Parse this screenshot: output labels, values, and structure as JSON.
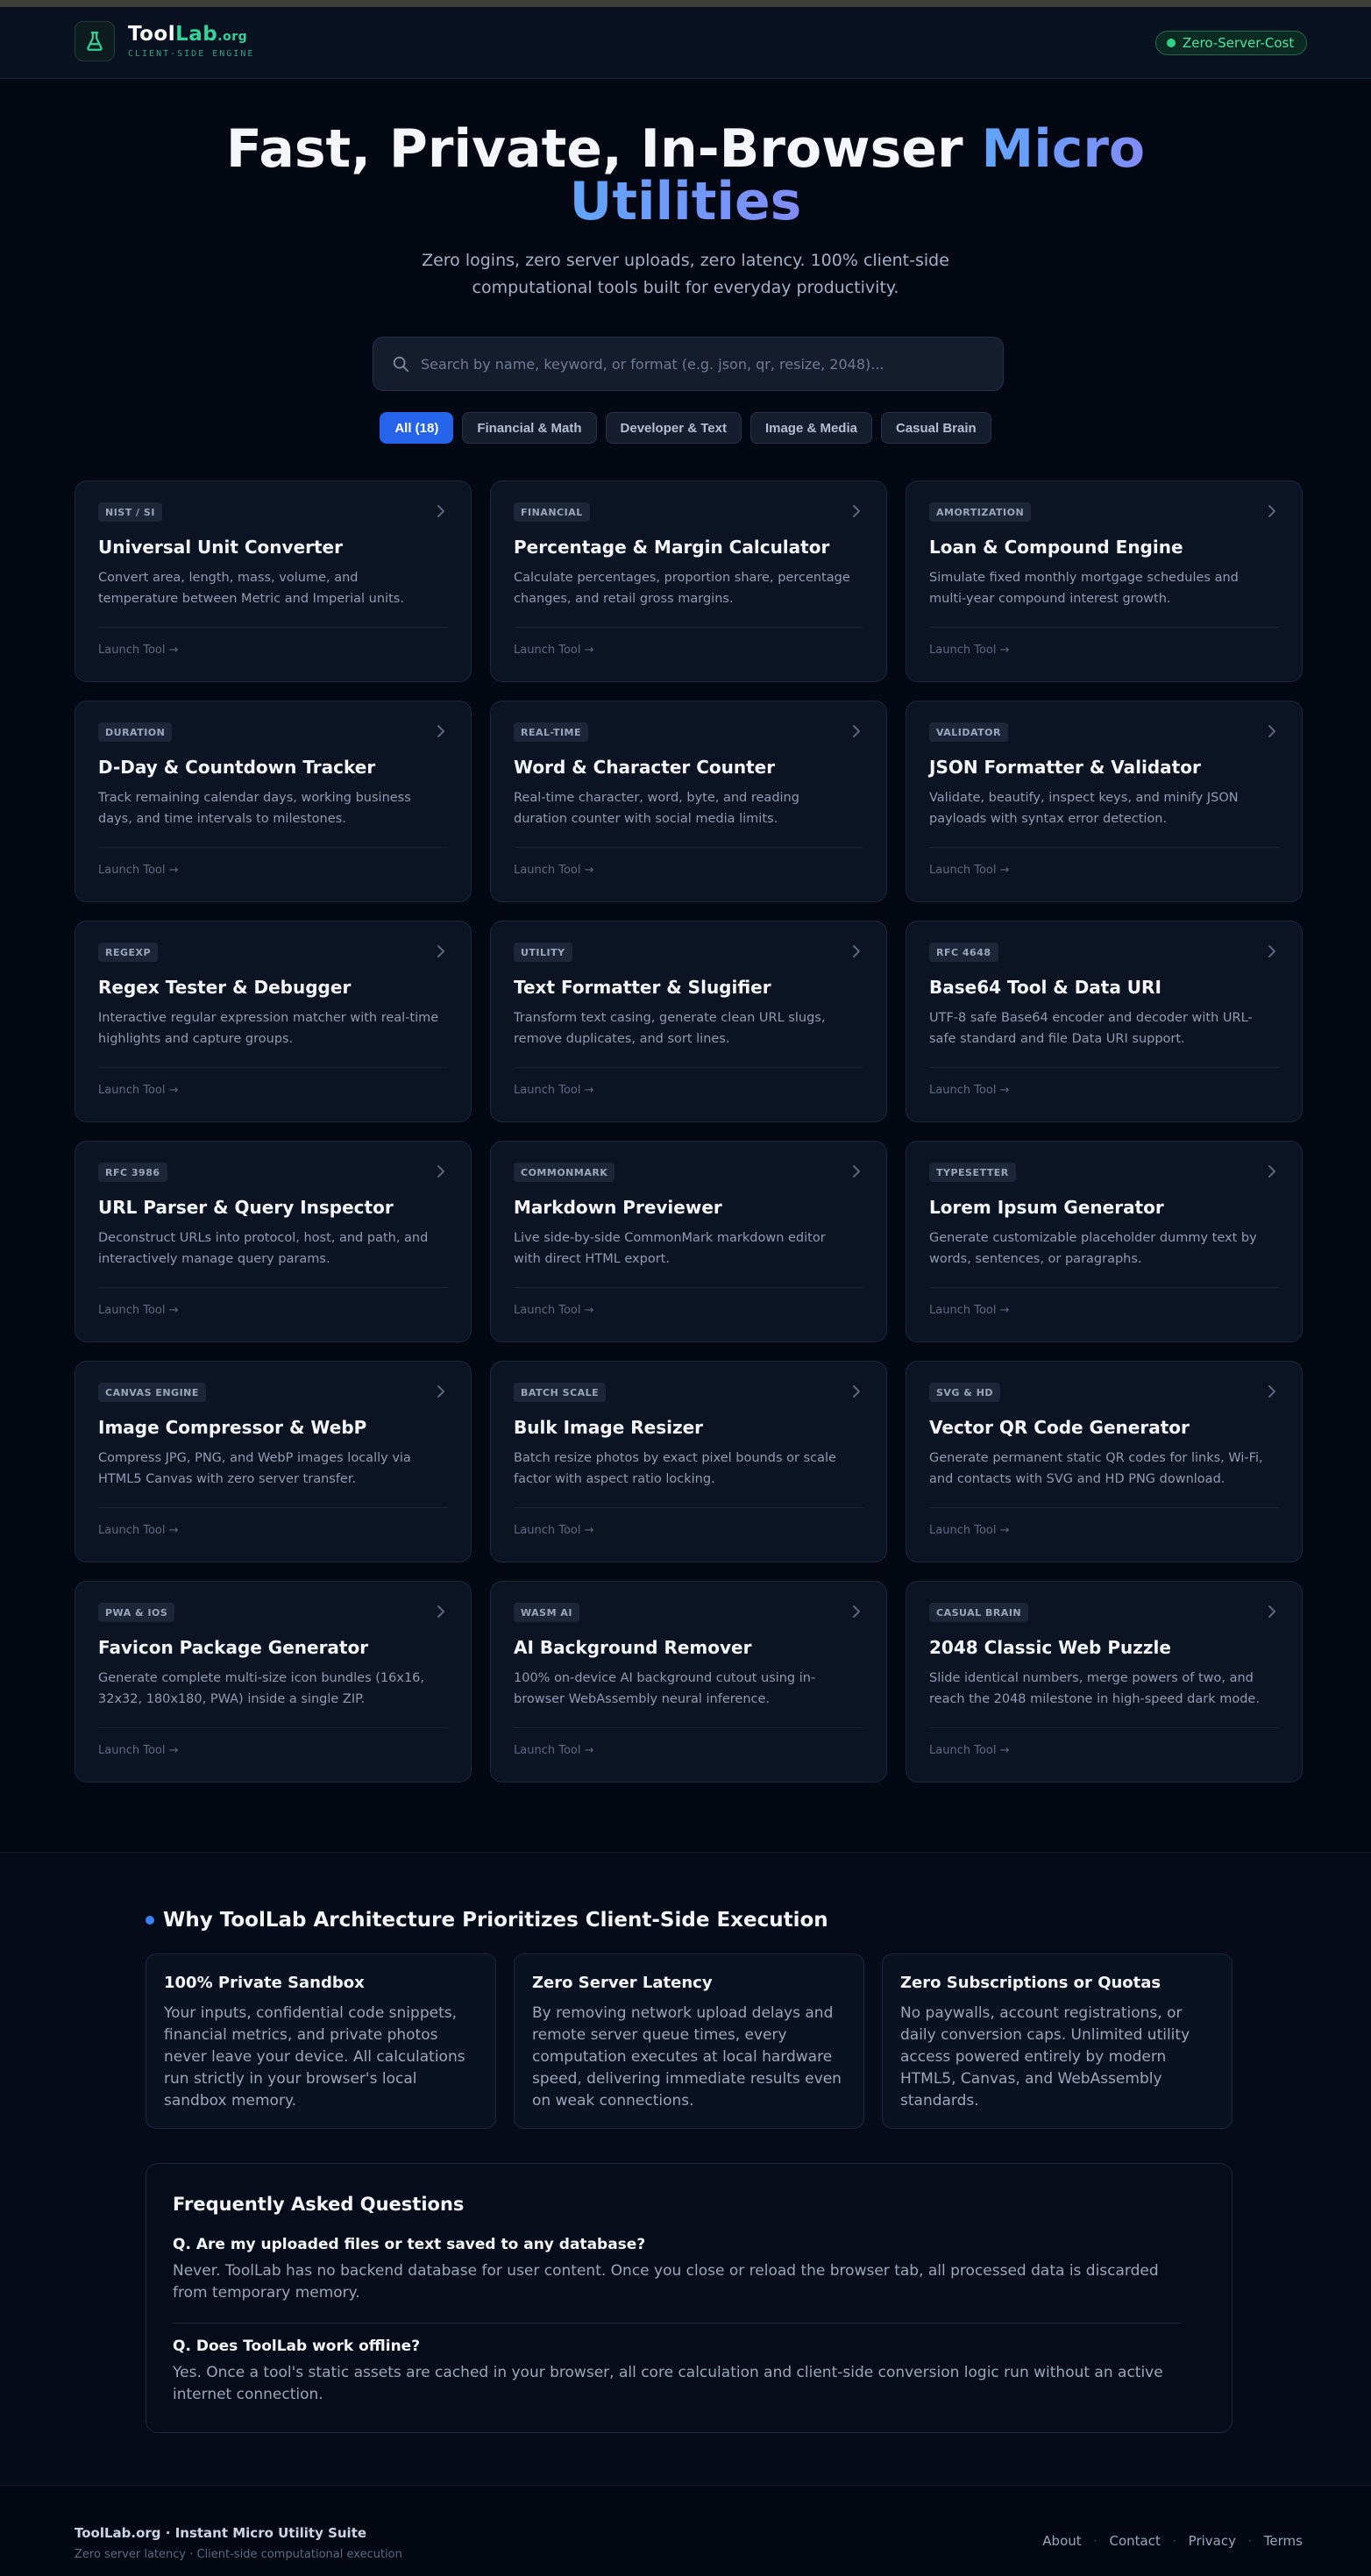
{
  "header": {
    "brand_part1": "Tool",
    "brand_part2": "Lab",
    "brand_tld": ".org",
    "tagline": "CLIENT-SIDE ENGINE",
    "status_badge": "Zero-Server-Cost"
  },
  "hero": {
    "title_plain": "Fast, Private, In-Browser",
    "title_accent_1": "Micro",
    "title_accent_2": "Utilities",
    "subtitle": "Zero logins, zero server uploads, zero latency. 100% client-side computational tools built for everyday productivity."
  },
  "search": {
    "placeholder": "Search by name, keyword, or format (e.g. json, qr, resize, 2048)...",
    "value": ""
  },
  "filters": [
    {
      "label": "All (18)",
      "active": true
    },
    {
      "label": "Financial & Math",
      "active": false
    },
    {
      "label": "Developer & Text",
      "active": false
    },
    {
      "label": "Image & Media",
      "active": false
    },
    {
      "label": "Casual Brain",
      "active": false
    }
  ],
  "tools": [
    {
      "badge": "NIST / SI",
      "title": "Universal Unit Converter",
      "desc": "Convert area, length, mass, volume, and temperature between Metric and Imperial units.",
      "link": "Launch Tool →"
    },
    {
      "badge": "FINANCIAL",
      "title": "Percentage & Margin Calculator",
      "desc": "Calculate percentages, proportion share, percentage changes, and retail gross margins.",
      "link": "Launch Tool →"
    },
    {
      "badge": "AMORTIZATION",
      "title": "Loan & Compound Engine",
      "desc": "Simulate fixed monthly mortgage schedules and multi-year compound interest growth.",
      "link": "Launch Tool →"
    },
    {
      "badge": "DURATION",
      "title": "D-Day & Countdown Tracker",
      "desc": "Track remaining calendar days, working business days, and time intervals to milestones.",
      "link": "Launch Tool →"
    },
    {
      "badge": "REAL-TIME",
      "title": "Word & Character Counter",
      "desc": "Real-time character, word, byte, and reading duration counter with social media limits.",
      "link": "Launch Tool →"
    },
    {
      "badge": "VALIDATOR",
      "title": "JSON Formatter & Validator",
      "desc": "Validate, beautify, inspect keys, and minify JSON payloads with syntax error detection.",
      "link": "Launch Tool →"
    },
    {
      "badge": "REGEXP",
      "title": "Regex Tester & Debugger",
      "desc": "Interactive regular expression matcher with real-time highlights and capture groups.",
      "link": "Launch Tool →"
    },
    {
      "badge": "UTILITY",
      "title": "Text Formatter & Slugifier",
      "desc": "Transform text casing, generate clean URL slugs, remove duplicates, and sort lines.",
      "link": "Launch Tool →"
    },
    {
      "badge": "RFC 4648",
      "title": "Base64 Tool & Data URI",
      "desc": "UTF-8 safe Base64 encoder and decoder with URL-safe standard and file Data URI support.",
      "link": "Launch Tool →"
    },
    {
      "badge": "RFC 3986",
      "title": "URL Parser & Query Inspector",
      "desc": "Deconstruct URLs into protocol, host, and path, and interactively manage query params.",
      "link": "Launch Tool →"
    },
    {
      "badge": "COMMONMARK",
      "title": "Markdown Previewer",
      "desc": "Live side-by-side CommonMark markdown editor with direct HTML export.",
      "link": "Launch Tool →"
    },
    {
      "badge": "TYPESETTER",
      "title": "Lorem Ipsum Generator",
      "desc": "Generate customizable placeholder dummy text by words, sentences, or paragraphs.",
      "link": "Launch Tool →"
    },
    {
      "badge": "CANVAS ENGINE",
      "title": "Image Compressor & WebP",
      "desc": "Compress JPG, PNG, and WebP images locally via HTML5 Canvas with zero server transfer.",
      "link": "Launch Tool →"
    },
    {
      "badge": "BATCH SCALE",
      "title": "Bulk Image Resizer",
      "desc": "Batch resize photos by exact pixel bounds or scale factor with aspect ratio locking.",
      "link": "Launch Tool →"
    },
    {
      "badge": "SVG & HD",
      "title": "Vector QR Code Generator",
      "desc": "Generate permanent static QR codes for links, Wi-Fi, and contacts with SVG and HD PNG download.",
      "link": "Launch Tool →"
    },
    {
      "badge": "PWA & IOS",
      "title": "Favicon Package Generator",
      "desc": "Generate complete multi-size icon bundles (16x16, 32x32, 180x180, PWA) inside a single ZIP.",
      "link": "Launch Tool →"
    },
    {
      "badge": "WASM AI",
      "title": "AI Background Remover",
      "desc": "100% on-device AI background cutout using in-browser WebAssembly neural inference.",
      "link": "Launch Tool →"
    },
    {
      "badge": "CASUAL BRAIN",
      "title": "2048 Classic Web Puzzle",
      "desc": "Slide identical numbers, merge powers of two, and reach the 2048 milestone in high-speed dark mode.",
      "link": "Launch Tool →"
    }
  ],
  "why": {
    "title": "Why ToolLab Architecture Prioritizes Client-Side Execution",
    "cards": [
      {
        "title": "100% Private Sandbox",
        "text": "Your inputs, confidential code snippets, financial metrics, and private photos never leave your device. All calculations run strictly in your browser's local sandbox memory."
      },
      {
        "title": "Zero Server Latency",
        "text": "By removing network upload delays and remote server queue times, every computation executes at local hardware speed, delivering immediate results even on weak connections."
      },
      {
        "title": "Zero Subscriptions or Quotas",
        "text": "No paywalls, account registrations, or daily conversion caps. Unlimited utility access powered entirely by modern HTML5, Canvas, and WebAssembly standards."
      }
    ]
  },
  "faq": {
    "title": "Frequently Asked Questions",
    "items": [
      {
        "q": "Q. Are my uploaded files or text saved to any database?",
        "a": "Never. ToolLab has no backend database for user content. Once you close or reload the browser tab, all processed data is discarded from temporary memory."
      },
      {
        "q": "Q. Does ToolLab work offline?",
        "a": "Yes. Once a tool's static assets are cached in your browser, all core calculation and client-side conversion logic run without an active internet connection."
      }
    ]
  },
  "footer": {
    "name": "ToolLab.org · Instant Micro Utility Suite",
    "sub": "Zero server latency · Client-side computational execution",
    "links": [
      "About",
      "Contact",
      "Privacy",
      "Terms"
    ]
  },
  "colors": {
    "background": "#030812",
    "brand_green": "#34d399",
    "accent_blue": "#60a5fa",
    "active_chip": "#2563eb"
  },
  "icons": [
    "flask-icon",
    "status-dot-icon",
    "search-icon",
    "chevron-right-icon",
    "bullet-dot-icon"
  ]
}
